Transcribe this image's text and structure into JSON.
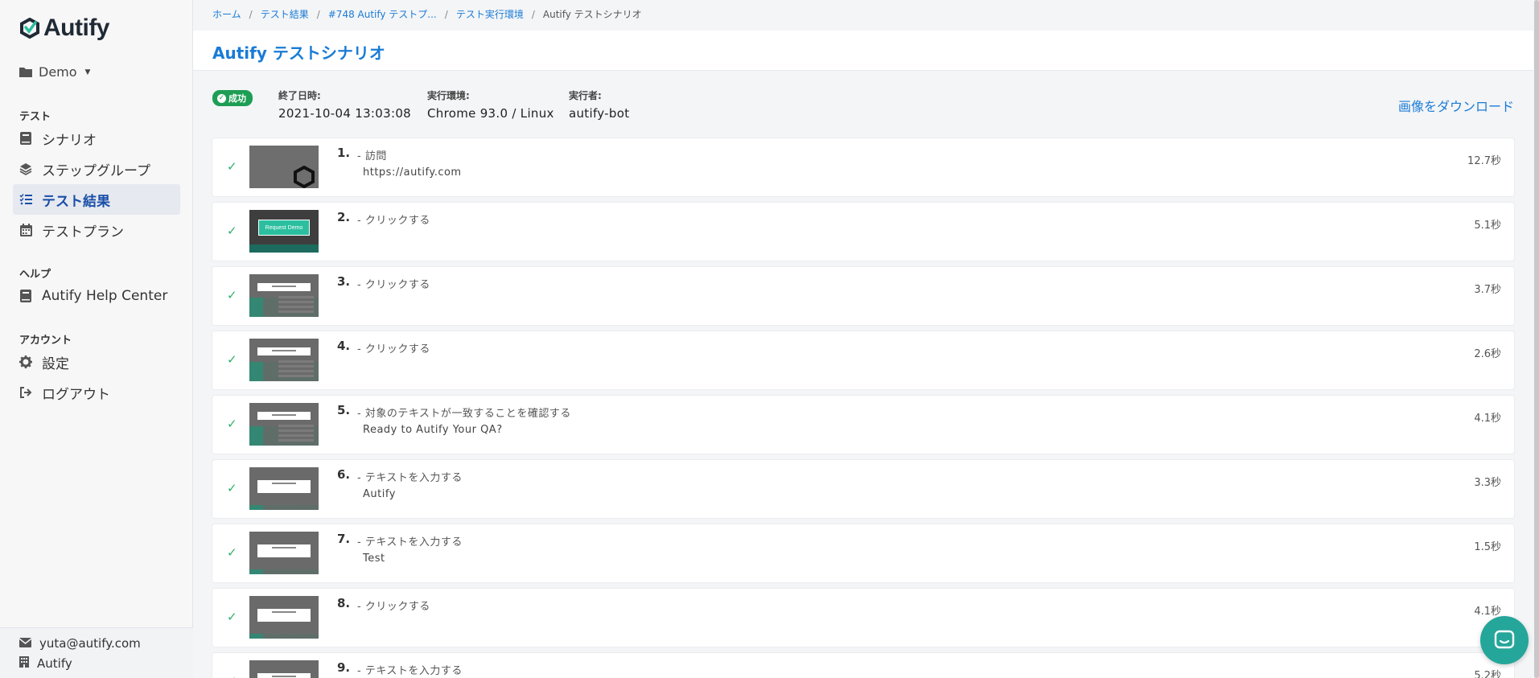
{
  "brand": {
    "name": "Autify"
  },
  "workspace": {
    "label": "Demo"
  },
  "sidebar": {
    "sections": [
      {
        "title": "テスト"
      },
      {
        "title": "ヘルプ"
      },
      {
        "title": "アカウント"
      }
    ],
    "items": [
      {
        "label": "シナリオ",
        "icon": "book-icon"
      },
      {
        "label": "ステップグループ",
        "icon": "layers-icon"
      },
      {
        "label": "テスト結果",
        "icon": "list-check-icon"
      },
      {
        "label": "テストプラン",
        "icon": "calendar-icon"
      },
      {
        "label": "Autify Help Center",
        "icon": "book-icon"
      },
      {
        "label": "設定",
        "icon": "gear-icon"
      },
      {
        "label": "ログアウト",
        "icon": "sign-out-icon"
      }
    ],
    "footer": {
      "email": "yuta@autify.com",
      "org": "Autify"
    }
  },
  "breadcrumb": {
    "home": "ホーム",
    "results": "テスト結果",
    "run": "#748 Autify テストプ...",
    "env": "テスト実行環境",
    "current": "Autify テストシナリオ"
  },
  "page": {
    "title": "Autify テストシナリオ"
  },
  "meta": {
    "status": "成功",
    "finished_label": "終了日時:",
    "finished_value": "2021-10-04 13:03:08",
    "env_label": "実行環境:",
    "env_value": "Chrome 93.0 / Linux",
    "runner_label": "実行者:",
    "runner_value": "autify-bot",
    "download": "画像をダウンロード"
  },
  "steps": [
    {
      "num": "1.",
      "action": "- 訪問",
      "detail": "https://autify.com",
      "time": "12.7秒",
      "thumb": "visit"
    },
    {
      "num": "2.",
      "action": "- クリックする",
      "detail": "",
      "time": "5.1秒",
      "thumb": "demo",
      "thumb_text": "Request Demo"
    },
    {
      "num": "3.",
      "action": "- クリックする",
      "detail": "",
      "time": "3.7秒",
      "thumb": "modal"
    },
    {
      "num": "4.",
      "action": "- クリックする",
      "detail": "",
      "time": "2.6秒",
      "thumb": "modal"
    },
    {
      "num": "5.",
      "action": "- 対象のテキストが一致することを確認する",
      "detail": "Ready to Autify Your QA?",
      "time": "4.1秒",
      "thumb": "modal"
    },
    {
      "num": "6.",
      "action": "- テキストを入力する",
      "detail": "Autify",
      "time": "3.3秒",
      "thumb": "modal-lg"
    },
    {
      "num": "7.",
      "action": "- テキストを入力する",
      "detail": "Test",
      "time": "1.5秒",
      "thumb": "modal-lg"
    },
    {
      "num": "8.",
      "action": "- クリックする",
      "detail": "",
      "time": "4.1秒",
      "thumb": "modal-lg"
    },
    {
      "num": "9.",
      "action": "- テキストを入力する",
      "detail": "",
      "time": "5.2秒",
      "thumb": "modal-lg"
    }
  ],
  "colors": {
    "accent": "#1a7bd6",
    "success": "#1e9e55",
    "chat": "#25a69a"
  }
}
